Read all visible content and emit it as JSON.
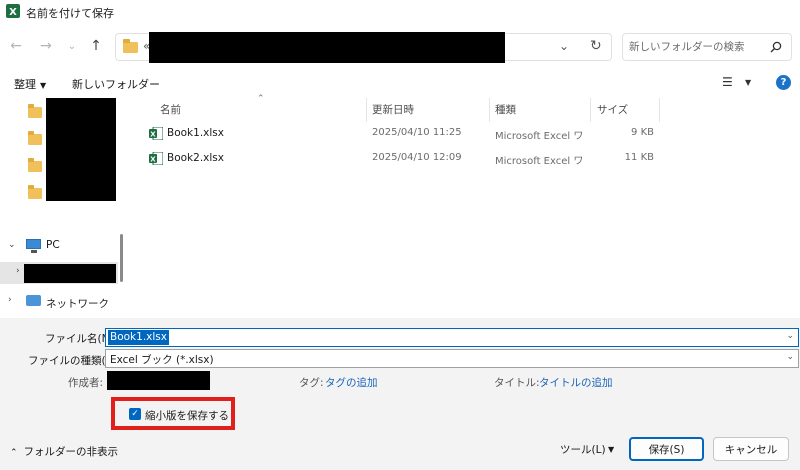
{
  "window": {
    "title": "名前を付けて保存"
  },
  "address": {
    "chevrons": "«"
  },
  "search": {
    "placeholder": "新しいフォルダーの検索"
  },
  "toolbar": {
    "organize": "整理",
    "new_folder": "新しいフォルダー"
  },
  "nav": {
    "pc_label": "PC",
    "network_label": "ネットワーク"
  },
  "columns": {
    "name": "名前",
    "modified": "更新日時",
    "type": "種類",
    "size": "サイズ"
  },
  "files": [
    {
      "name": "Book1.xlsx",
      "modified": "2025/04/10 11:25",
      "type": "Microsoft Excel ワ",
      "size": "9 KB"
    },
    {
      "name": "Book2.xlsx",
      "modified": "2025/04/10 12:09",
      "type": "Microsoft Excel ワ",
      "size": "11 KB"
    }
  ],
  "form": {
    "filename_label": "ファイル名(N):",
    "filename_value": "Book1.xlsx",
    "filetype_label": "ファイルの種類(T):",
    "filetype_value": "Excel ブック (*.xlsx)",
    "author_label": "作成者:",
    "tags_label": "タグ:",
    "tags_link": "タグの追加",
    "title_label": "タイトル:",
    "title_link": "タイトルの追加",
    "thumbnail_label": "縮小版を保存する",
    "thumbnail_checked": true
  },
  "footer": {
    "hide_folders": "フォルダーの非表示",
    "tools": "ツール(L)",
    "save": "保存(S)",
    "cancel": "キャンセル"
  },
  "colors": {
    "accent": "#0067c0",
    "highlight": "#e0201b",
    "excel_green": "#1d6f42"
  }
}
